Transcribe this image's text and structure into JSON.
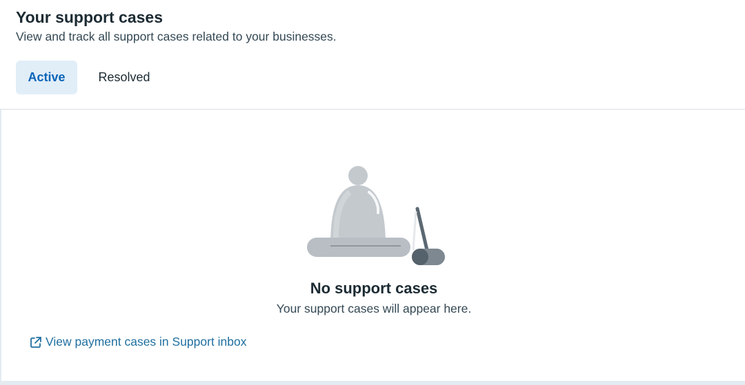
{
  "header": {
    "title": "Your support cases",
    "subtitle": "View and track all support cases related to your businesses."
  },
  "tabs": [
    {
      "label": "Active",
      "selected": true
    },
    {
      "label": "Resolved",
      "selected": false
    }
  ],
  "empty_state": {
    "icon": "bell-icon",
    "title": "No support cases",
    "description": "Your support cases will appear here."
  },
  "link": {
    "icon": "external-link-icon",
    "label": "View payment cases in Support inbox"
  },
  "colors": {
    "accent": "#0b64b8",
    "link": "#1f6fa0",
    "active_tab_bg": "#e1eef8",
    "page_bg": "#e4ecf2"
  }
}
